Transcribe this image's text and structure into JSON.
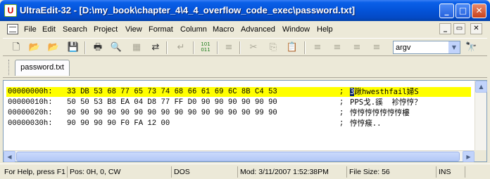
{
  "window": {
    "app_icon_letter": "U",
    "title": "UltraEdit-32 - [D:\\my_book\\chapter_4\\4_4_overflow_code_exec\\password.txt]",
    "buttons": {
      "minimize": "_",
      "maximize": "□",
      "close": "✕"
    }
  },
  "menu": {
    "items": [
      "File",
      "Edit",
      "Search",
      "Project",
      "View",
      "Format",
      "Column",
      "Macro",
      "Advanced",
      "Window",
      "Help"
    ],
    "mdi_buttons": {
      "minimize": "_",
      "restore": "▭",
      "close": "✕"
    }
  },
  "toolbar": {
    "icons": {
      "new": "🗋",
      "open": "📂",
      "open_recent": "📂",
      "save": "💾",
      "print": "🖶",
      "print_preview": "🔍",
      "hex": "▦",
      "ftp": "⇄",
      "word_wrap": "↵",
      "hex_toggle": "101\n011",
      "format": "≡",
      "cut": "✂",
      "copy": "⎘",
      "paste": "📋",
      "align_left": "≡",
      "align_center": "≡",
      "align_right": "≡",
      "justify": "≡"
    },
    "search_value": "argv",
    "find_icon": "🔭"
  },
  "tabs": [
    {
      "label": "password.txt"
    }
  ],
  "hex": {
    "lines": [
      {
        "addr": "00000000h:",
        "bytes": "33 DB 53 68 77 65 73 74 68 66 61 69 6C 8B C4 53",
        "sep": ";",
        "ascii_caret": "3",
        "ascii": "踿hwesthfail婦S",
        "highlight": true
      },
      {
        "addr": "00000010h:",
        "bytes": "50 50 53 B8 EA 04 D8 77 FF D0 90 90 90 90 90 90",
        "sep": ";",
        "ascii_caret": "",
        "ascii": "PPS戈.豀  袗悙悙？",
        "highlight": false
      },
      {
        "addr": "00000020h:",
        "bytes": "90 90 90 90 90 90 90 90 90 90 90 90 90 90 99 90",
        "sep": ";",
        "ascii_caret": "",
        "ascii": "悙悙悙悙悙悙悙樓",
        "highlight": false
      },
      {
        "addr": "00000030h:",
        "bytes": "90 90 90 90 F0 FA 12 00",
        "sep": ";",
        "ascii_caret": "",
        "ascii": "悙悙瘊..",
        "highlight": false
      }
    ]
  },
  "scroll": {
    "up": "▲",
    "left": "◀",
    "right": "▶"
  },
  "status": {
    "help": "For Help, press F1",
    "position": "Pos: 0H, 0, CW",
    "format": "DOS",
    "modified": "Mod: 3/11/2007 1:52:38PM",
    "file_size": "File Size: 56",
    "mode": "INS"
  }
}
